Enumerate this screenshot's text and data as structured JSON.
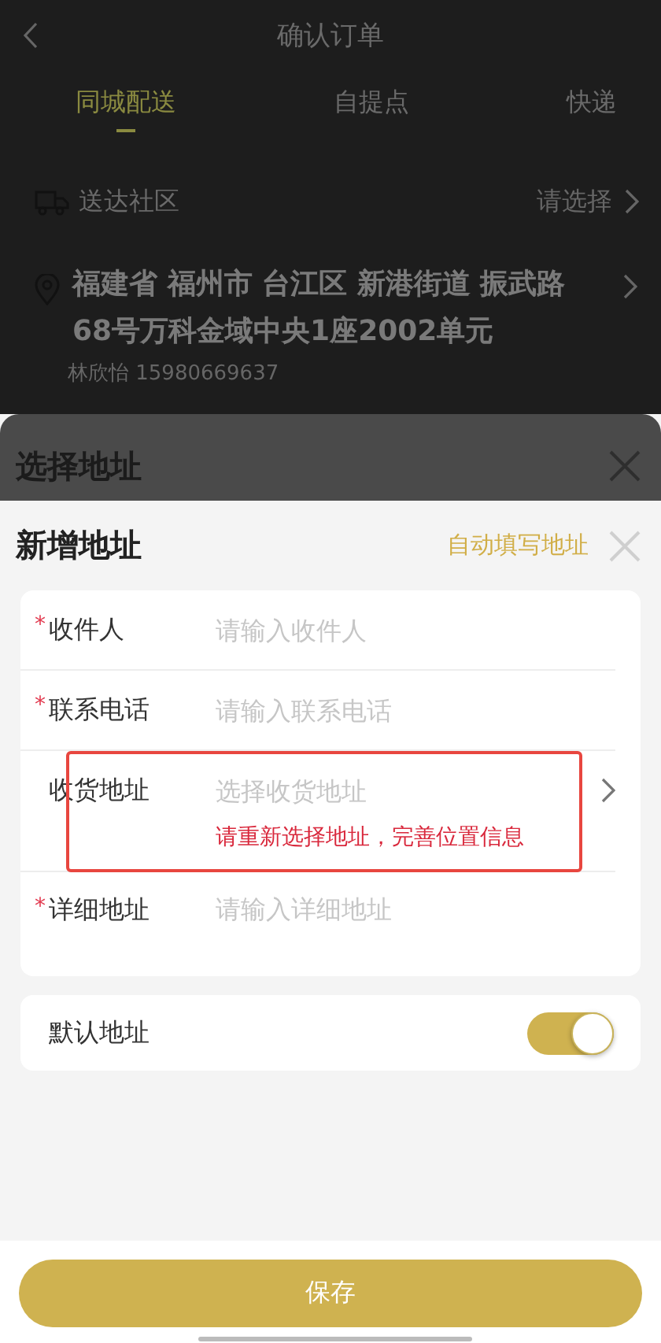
{
  "order_page": {
    "title": "确认订单",
    "tabs": [
      {
        "label": "同城配送",
        "selected": true
      },
      {
        "label": "自提点",
        "selected": false
      },
      {
        "label": "快递",
        "selected": false
      }
    ],
    "community": {
      "label": "送达社区",
      "value": "请选择"
    },
    "address": {
      "text": "福建省 福州市 台江区 新港街道 振武路68号万科金域中央1座2002单元",
      "contact": "林欣怡 15980669637"
    }
  },
  "select_sheet": {
    "title": "选择地址"
  },
  "new_address": {
    "title": "新增地址",
    "auto_fill": "自动填写地址",
    "fields": [
      {
        "kind": "text",
        "label": "收件人",
        "marker": "*",
        "placeholder": "请输入收件人"
      },
      {
        "kind": "text",
        "label": "联系电话",
        "marker": "*",
        "placeholder": "请输入联系电话"
      },
      {
        "kind": "picker",
        "label": "收货地址",
        "placeholder": "选择收货地址",
        "error": "请重新选择地址，完善位置信息"
      },
      {
        "kind": "textarea",
        "label": "详细地址",
        "marker": "*",
        "placeholder": "请输入详细地址"
      }
    ],
    "default_address": {
      "label": "默认地址",
      "on": true
    },
    "save": "保存"
  }
}
